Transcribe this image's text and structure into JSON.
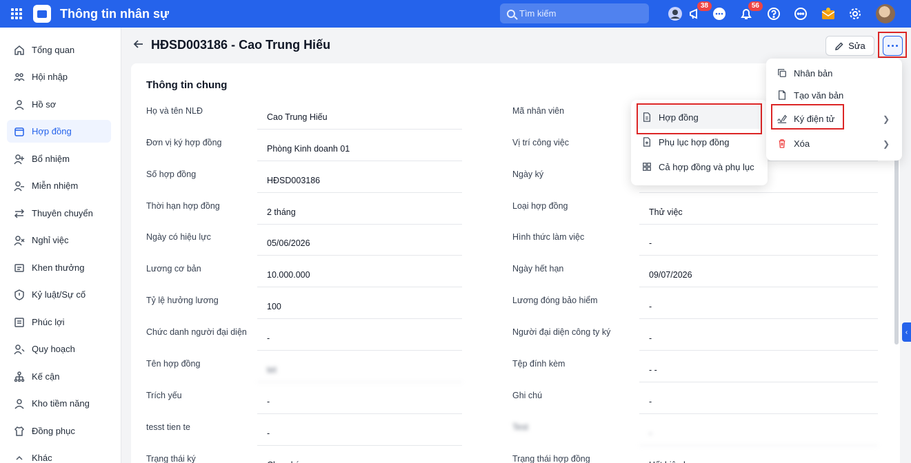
{
  "header": {
    "app_title": "Thông tin nhân sự",
    "search_placeholder": "Tìm kiếm",
    "badges": {
      "announce": "38",
      "bell": "56"
    }
  },
  "sidebar": {
    "items": [
      {
        "label": "Tổng quan",
        "icon": "home-icon"
      },
      {
        "label": "Hội nhập",
        "icon": "onboarding-icon"
      },
      {
        "label": "Hồ sơ",
        "icon": "profile-icon"
      },
      {
        "label": "Hợp đồng",
        "icon": "contract-icon"
      },
      {
        "label": "Bổ nhiệm",
        "icon": "appoint-icon"
      },
      {
        "label": "Miễn nhiệm",
        "icon": "dismiss-icon"
      },
      {
        "label": "Thuyên chuyển",
        "icon": "transfer-icon"
      },
      {
        "label": "Nghỉ việc",
        "icon": "resign-icon"
      },
      {
        "label": "Khen thưởng",
        "icon": "reward-icon"
      },
      {
        "label": "Kỷ luật/Sự cố",
        "icon": "discipline-icon"
      },
      {
        "label": "Phúc lợi",
        "icon": "welfare-icon"
      },
      {
        "label": "Quy hoạch",
        "icon": "planning-icon"
      },
      {
        "label": "Kế cận",
        "icon": "succession-icon"
      },
      {
        "label": "Kho tiềm năng",
        "icon": "talent-pool-icon"
      },
      {
        "label": "Đồng phục",
        "icon": "uniform-icon"
      },
      {
        "label": "Khác",
        "icon": "other-icon"
      }
    ],
    "active_index": 3
  },
  "page": {
    "title": "HĐSD003186 - Cao Trung Hiếu",
    "edit_label": "Sửa",
    "section_title": "Thông tin chung"
  },
  "fields_left": [
    {
      "label": "Họ và tên NLĐ",
      "value": "Cao Trung Hiếu"
    },
    {
      "label": "Đơn vị ký hợp đồng",
      "value": "Phòng Kinh doanh 01"
    },
    {
      "label": "Số hợp đồng",
      "value": "HĐSD003186"
    },
    {
      "label": "Thời hạn hợp đồng",
      "value": "2 tháng"
    },
    {
      "label": "Ngày có hiệu lực",
      "value": "05/06/2026"
    },
    {
      "label": "Lương cơ bản",
      "value": "10.000.000"
    },
    {
      "label": "Tỷ lệ hưởng lương",
      "value": "100"
    },
    {
      "label": "Chức danh người đại diện",
      "value": "-"
    },
    {
      "label": "Tên hợp đồng",
      "value": "tet"
    },
    {
      "label": "Trích yếu",
      "value": "-"
    },
    {
      "label": "tesst tien te",
      "value": "-"
    },
    {
      "label": "Trạng thái ký",
      "value": "Chưa ký"
    }
  ],
  "fields_right": [
    {
      "label": "Mã nhân viên",
      "value": ""
    },
    {
      "label": "Vị trí công việc",
      "value": ""
    },
    {
      "label": "Ngày ký",
      "value": ""
    },
    {
      "label": "Loại hợp đồng",
      "value": "Thử việc"
    },
    {
      "label": "Hình thức làm việc",
      "value": "-"
    },
    {
      "label": "Ngày hết hạn",
      "value": "09/07/2026"
    },
    {
      "label": "Lương đóng bảo hiểm",
      "value": "-"
    },
    {
      "label": "Người đại diện công ty ký",
      "value": "-"
    },
    {
      "label": "Tệp đính kèm",
      "value": "- -"
    },
    {
      "label": "Ghi chú",
      "value": "-"
    },
    {
      "label": "Test",
      "value": "-"
    },
    {
      "label": "Trạng thái hợp đồng",
      "value": "Hết hiệu lực"
    }
  ],
  "more_menu": {
    "items": [
      {
        "label": "Nhân bản",
        "icon": "copy-icon"
      },
      {
        "label": "Tạo văn bản",
        "icon": "document-icon"
      },
      {
        "label": "Ký điện tử",
        "icon": "signature-icon",
        "submenu": true
      },
      {
        "label": "Xóa",
        "icon": "trash-icon",
        "submenu": true
      }
    ]
  },
  "sign_submenu": {
    "items": [
      {
        "label": "Hợp đồng",
        "icon": "contract-doc-icon"
      },
      {
        "label": "Phụ lục hợp đồng",
        "icon": "appendix-icon"
      },
      {
        "label": "Cả hợp đồng và phụ lục",
        "icon": "grid-icon"
      }
    ]
  },
  "colors": {
    "primary": "#2563eb",
    "highlight": "#dc2626",
    "danger": "#ef4444"
  }
}
